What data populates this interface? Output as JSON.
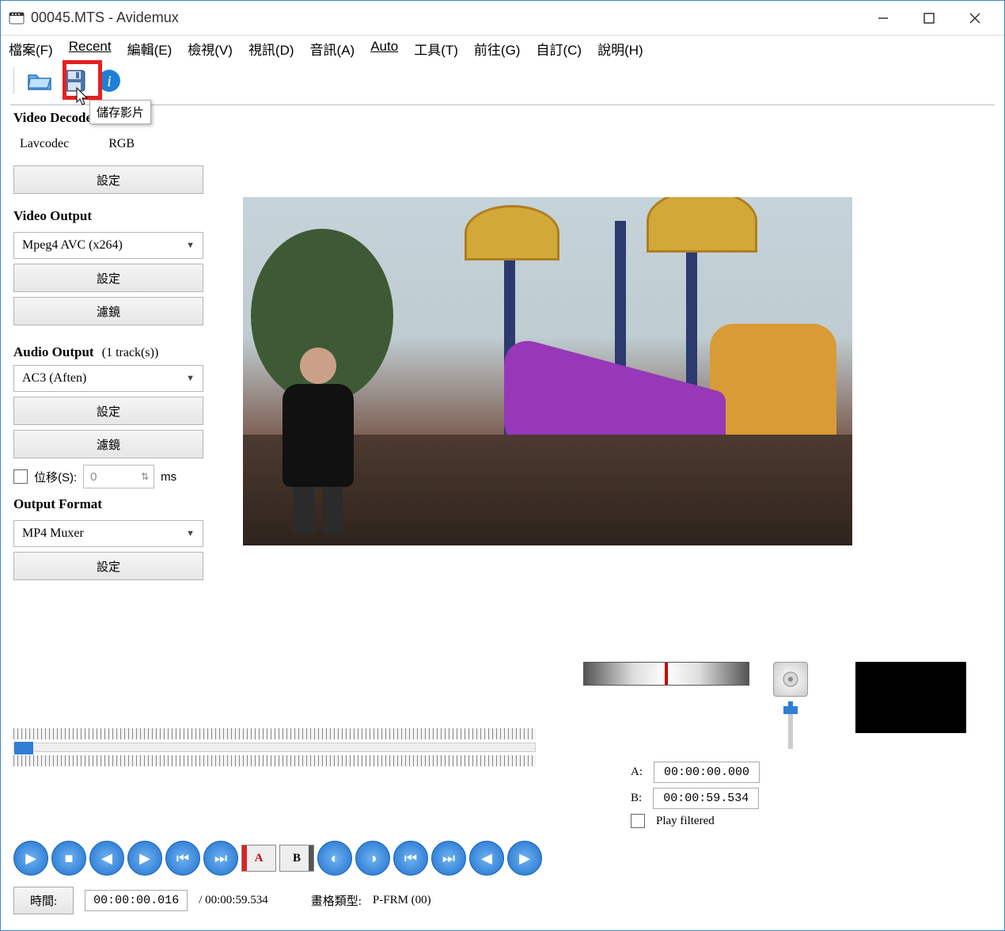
{
  "titlebar": {
    "title": "00045.MTS - Avidemux"
  },
  "menu": {
    "file": "檔案(F)",
    "recent": "Recent",
    "edit": "編輯(E)",
    "view": "檢視(V)",
    "video": "視訊(D)",
    "audio": "音訊(A)",
    "auto": "Auto",
    "tools": "工具(T)",
    "go": "前往(G)",
    "custom": "自訂(C)",
    "help": "說明(H)"
  },
  "toolbar": {
    "tooltip_save": "儲存影片"
  },
  "sidebar": {
    "video_decoder": {
      "label": "Video Decoder",
      "row1": "Lavcodec",
      "row2": "RGB",
      "setup": "設定"
    },
    "video_output": {
      "label": "Video Output",
      "selected": "Mpeg4 AVC (x264)",
      "setup": "設定",
      "filter": "濾鏡"
    },
    "audio_output": {
      "label": "Audio Output",
      "tracks": "(1 track(s))",
      "selected": "AC3 (Aften)",
      "setup": "設定",
      "filter": "濾鏡",
      "shift_label": "位移(S):",
      "shift_value": "0",
      "ms": "ms"
    },
    "output_format": {
      "label": "Output Format",
      "selected": "MP4 Muxer",
      "setup": "設定"
    }
  },
  "playback": {
    "a_label": "A:",
    "a_time": "00:00:00.000",
    "b_label": "B:",
    "b_time": "00:00:59.534",
    "play_filtered": "Play filtered"
  },
  "timebar": {
    "time_btn": "時間:",
    "current": "00:00:00.016",
    "total": "/ 00:00:59.534",
    "frame_type_label": "畫格類型:",
    "frame_type": "P-FRM (00)"
  }
}
